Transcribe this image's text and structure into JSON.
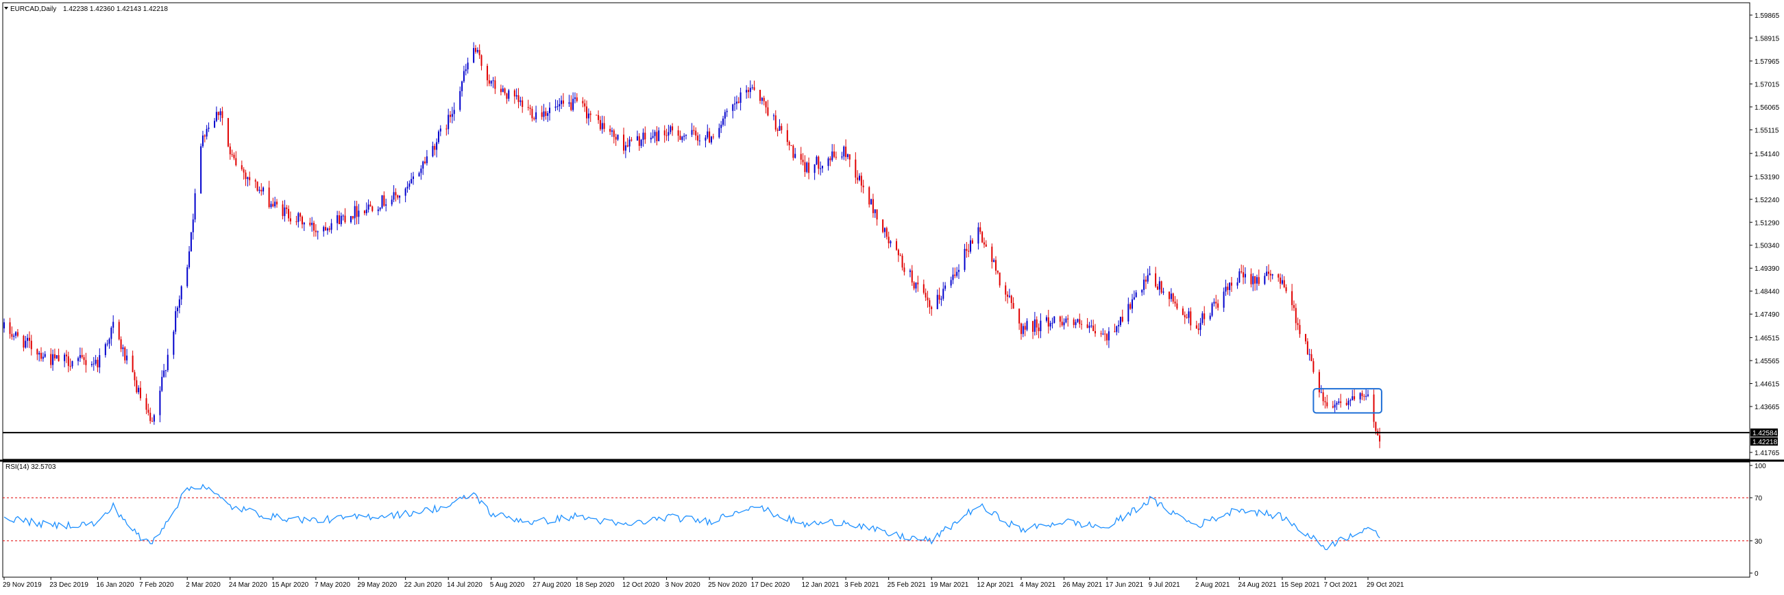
{
  "header": {
    "symbol_timeframe": "EURCAD,Daily",
    "ohlc": "1.42238 1.42360 1.42143 1.42218"
  },
  "rsi_header": {
    "label": "RSI(14) 32.5703"
  },
  "colors": {
    "bull_candle": "#0000cc",
    "bear_candle": "#e00000",
    "rsi_line": "#1e90ff",
    "rsi_levels": "#e00000",
    "box": "#1f6fd6",
    "support_line": "#000000"
  },
  "chart_data": [
    {
      "type": "candlestick",
      "symbol": "EURCAD",
      "timeframe": "Daily",
      "ylim": [
        1.41765,
        1.59865
      ],
      "y_tick_labels": [
        "1.59865",
        "1.58915",
        "1.57965",
        "1.57015",
        "1.56065",
        "1.55115",
        "1.54140",
        "1.53190",
        "1.52240",
        "1.51290",
        "1.50340",
        "1.49390",
        "1.48440",
        "1.47490",
        "1.46515",
        "1.45565",
        "1.44615",
        "1.43665",
        "1.42584",
        "1.42218",
        "1.41765"
      ],
      "x_tick_labels": [
        "29 Nov 2019",
        "23 Dec 2019",
        "16 Jan 2020",
        "7 Feb 2020",
        "2 Mar 2020",
        "24 Mar 2020",
        "15 Apr 2020",
        "7 May 2020",
        "29 May 2020",
        "22 Jun 2020",
        "14 Jul 2020",
        "5 Aug 2020",
        "27 Aug 2020",
        "18 Sep 2020",
        "12 Oct 2020",
        "3 Nov 2020",
        "25 Nov 2020",
        "17 Dec 2020",
        "12 Jan 2021",
        "3 Feb 2021",
        "25 Feb 2021",
        "19 Mar 2021",
        "12 Apr 2021",
        "4 May 2021",
        "26 May 2021",
        "17 Jun 2021",
        "9 Jul 2021",
        "2 Aug 2021",
        "24 Aug 2021",
        "15 Sep 2021",
        "7 Oct 2021",
        "29 Oct 2021"
      ],
      "approx_close_path": [
        {
          "date": "29 Nov 2019",
          "value": 1.469
        },
        {
          "date": "23 Dec 2019",
          "value": 1.456
        },
        {
          "date": "16 Jan 2020",
          "value": 1.455
        },
        {
          "date": "24 Jan 2020",
          "value": 1.47
        },
        {
          "date": "7 Feb 2020",
          "value": 1.44
        },
        {
          "date": "13 Feb 2020",
          "value": 1.428
        },
        {
          "date": "2 Mar 2020",
          "value": 1.496
        },
        {
          "date": "10 Mar 2020",
          "value": 1.55
        },
        {
          "date": "19 Mar 2020",
          "value": 1.56
        },
        {
          "date": "24 Mar 2020",
          "value": 1.54
        },
        {
          "date": "15 Apr 2020",
          "value": 1.52
        },
        {
          "date": "7 May 2020",
          "value": 1.51
        },
        {
          "date": "29 May 2020",
          "value": 1.518
        },
        {
          "date": "22 Jun 2020",
          "value": 1.525
        },
        {
          "date": "14 Jul 2020",
          "value": 1.555
        },
        {
          "date": "27 Jul 2020",
          "value": 1.585
        },
        {
          "date": "5 Aug 2020",
          "value": 1.57
        },
        {
          "date": "27 Aug 2020",
          "value": 1.558
        },
        {
          "date": "18 Sep 2020",
          "value": 1.562
        },
        {
          "date": "12 Oct 2020",
          "value": 1.545
        },
        {
          "date": "3 Nov 2020",
          "value": 1.55
        },
        {
          "date": "25 Nov 2020",
          "value": 1.548
        },
        {
          "date": "17 Dec 2020",
          "value": 1.57
        },
        {
          "date": "12 Jan 2021",
          "value": 1.535
        },
        {
          "date": "3 Feb 2021",
          "value": 1.542
        },
        {
          "date": "25 Feb 2021",
          "value": 1.505
        },
        {
          "date": "19 Mar 2021",
          "value": 1.476
        },
        {
          "date": "12 Apr 2021",
          "value": 1.51
        },
        {
          "date": "4 May 2021",
          "value": 1.469
        },
        {
          "date": "26 May 2021",
          "value": 1.473
        },
        {
          "date": "17 Jun 2021",
          "value": 1.465
        },
        {
          "date": "9 Jul 2021",
          "value": 1.49
        },
        {
          "date": "2 Aug 2021",
          "value": 1.47
        },
        {
          "date": "24 Aug 2021",
          "value": 1.49
        },
        {
          "date": "15 Sep 2021",
          "value": 1.49
        },
        {
          "date": "7 Oct 2021",
          "value": 1.438
        },
        {
          "date": "29 Oct 2021",
          "value": 1.44
        },
        {
          "date": "4 Nov 2021",
          "value": 1.4222
        }
      ],
      "horizontal_line": 1.42584,
      "current_price": 1.42218,
      "consolidation_box": {
        "start": "1 Oct 2021",
        "end": "5 Nov 2021",
        "low": 1.434,
        "high": 1.444
      }
    },
    {
      "type": "line",
      "name": "RSI(14)",
      "ylim": [
        0,
        100
      ],
      "y_tick_labels": [
        "100",
        "70",
        "30",
        "0"
      ],
      "levels": [
        70,
        30
      ],
      "last_value": 32.5703,
      "approx_path": [
        {
          "date": "29 Nov 2019",
          "value": 52
        },
        {
          "date": "23 Dec 2019",
          "value": 44
        },
        {
          "date": "16 Jan 2020",
          "value": 46
        },
        {
          "date": "24 Jan 2020",
          "value": 62
        },
        {
          "date": "7 Feb 2020",
          "value": 32
        },
        {
          "date": "13 Feb 2020",
          "value": 28
        },
        {
          "date": "2 Mar 2020",
          "value": 78
        },
        {
          "date": "10 Mar 2020",
          "value": 82
        },
        {
          "date": "24 Mar 2020",
          "value": 62
        },
        {
          "date": "15 Apr 2020",
          "value": 52
        },
        {
          "date": "7 May 2020",
          "value": 49
        },
        {
          "date": "29 May 2020",
          "value": 52
        },
        {
          "date": "22 Jun 2020",
          "value": 55
        },
        {
          "date": "14 Jul 2020",
          "value": 62
        },
        {
          "date": "27 Jul 2020",
          "value": 74
        },
        {
          "date": "5 Aug 2020",
          "value": 55
        },
        {
          "date": "27 Aug 2020",
          "value": 47
        },
        {
          "date": "18 Sep 2020",
          "value": 53
        },
        {
          "date": "12 Oct 2020",
          "value": 44
        },
        {
          "date": "3 Nov 2020",
          "value": 52
        },
        {
          "date": "25 Nov 2020",
          "value": 48
        },
        {
          "date": "17 Dec 2020",
          "value": 63
        },
        {
          "date": "12 Jan 2021",
          "value": 45
        },
        {
          "date": "3 Feb 2021",
          "value": 48
        },
        {
          "date": "25 Feb 2021",
          "value": 36
        },
        {
          "date": "19 Mar 2021",
          "value": 30
        },
        {
          "date": "12 Apr 2021",
          "value": 63
        },
        {
          "date": "4 May 2021",
          "value": 40
        },
        {
          "date": "26 May 2021",
          "value": 48
        },
        {
          "date": "17 Jun 2021",
          "value": 42
        },
        {
          "date": "9 Jul 2021",
          "value": 68
        },
        {
          "date": "2 Aug 2021",
          "value": 44
        },
        {
          "date": "24 Aug 2021",
          "value": 60
        },
        {
          "date": "15 Sep 2021",
          "value": 52
        },
        {
          "date": "7 Oct 2021",
          "value": 24
        },
        {
          "date": "29 Oct 2021",
          "value": 43
        },
        {
          "date": "4 Nov 2021",
          "value": 32.57
        }
      ]
    }
  ]
}
